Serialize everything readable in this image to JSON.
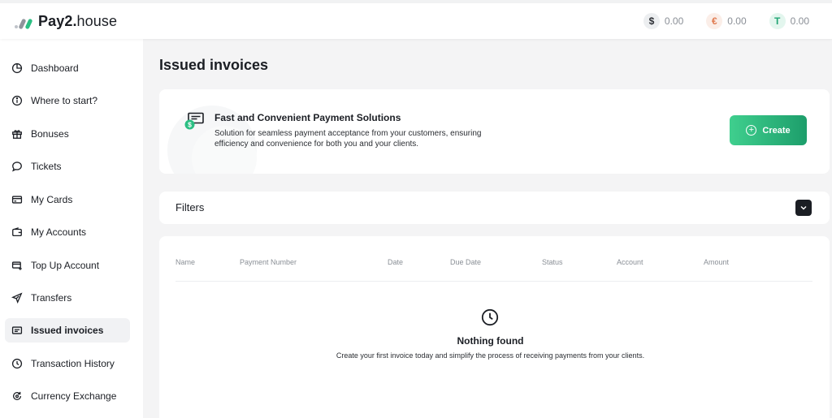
{
  "brand": {
    "name_bold": "Pay2.",
    "name_light": "house"
  },
  "balances": [
    {
      "symbol": "$",
      "value": "0.00",
      "icon": "dollar-icon",
      "color": "#2b2e33"
    },
    {
      "symbol": "€",
      "value": "0.00",
      "icon": "euro-icon",
      "color": "#e07a4f"
    },
    {
      "symbol": "T",
      "value": "0.00",
      "icon": "tether-icon",
      "color": "#21a574"
    }
  ],
  "sidebar": {
    "items": [
      {
        "label": "Dashboard",
        "icon": "chart-pie-icon",
        "active": false
      },
      {
        "label": "Where to start?",
        "icon": "info-icon",
        "active": false
      },
      {
        "label": "Bonuses",
        "icon": "gift-icon",
        "active": false
      },
      {
        "label": "Tickets",
        "icon": "chat-icon",
        "active": false
      },
      {
        "label": "My Cards",
        "icon": "card-icon",
        "active": false
      },
      {
        "label": "My Accounts",
        "icon": "wallet-icon",
        "active": false
      },
      {
        "label": "Top Up Account",
        "icon": "top-up-icon",
        "active": false
      },
      {
        "label": "Transfers",
        "icon": "send-icon",
        "active": false
      },
      {
        "label": "Issued invoices",
        "icon": "invoice-icon",
        "active": true
      },
      {
        "label": "Transaction History",
        "icon": "clock-icon",
        "active": false
      },
      {
        "label": "Currency Exchange",
        "icon": "exchange-icon",
        "active": false
      }
    ]
  },
  "main": {
    "title": "Issued invoices",
    "promo": {
      "title": "Fast and Convenient Payment Solutions",
      "description": "Solution for seamless payment acceptance from your customers, ensuring efficiency and convenience for both you and your clients.",
      "create_label": "Create",
      "icon": "invoice-payment-icon"
    },
    "filters": {
      "label": "Filters"
    },
    "table": {
      "columns": [
        "Name",
        "Payment Number",
        "Date",
        "Due Date",
        "Status",
        "Account",
        "Amount"
      ],
      "empty_title": "Nothing found",
      "empty_description": "Create your first invoice today and simplify the process of receiving payments from your clients."
    }
  },
  "colors": {
    "accent": "#2bbf83",
    "accent_dark": "#1d9e6b",
    "text": "#1b1e24",
    "muted": "#8a8f96"
  }
}
